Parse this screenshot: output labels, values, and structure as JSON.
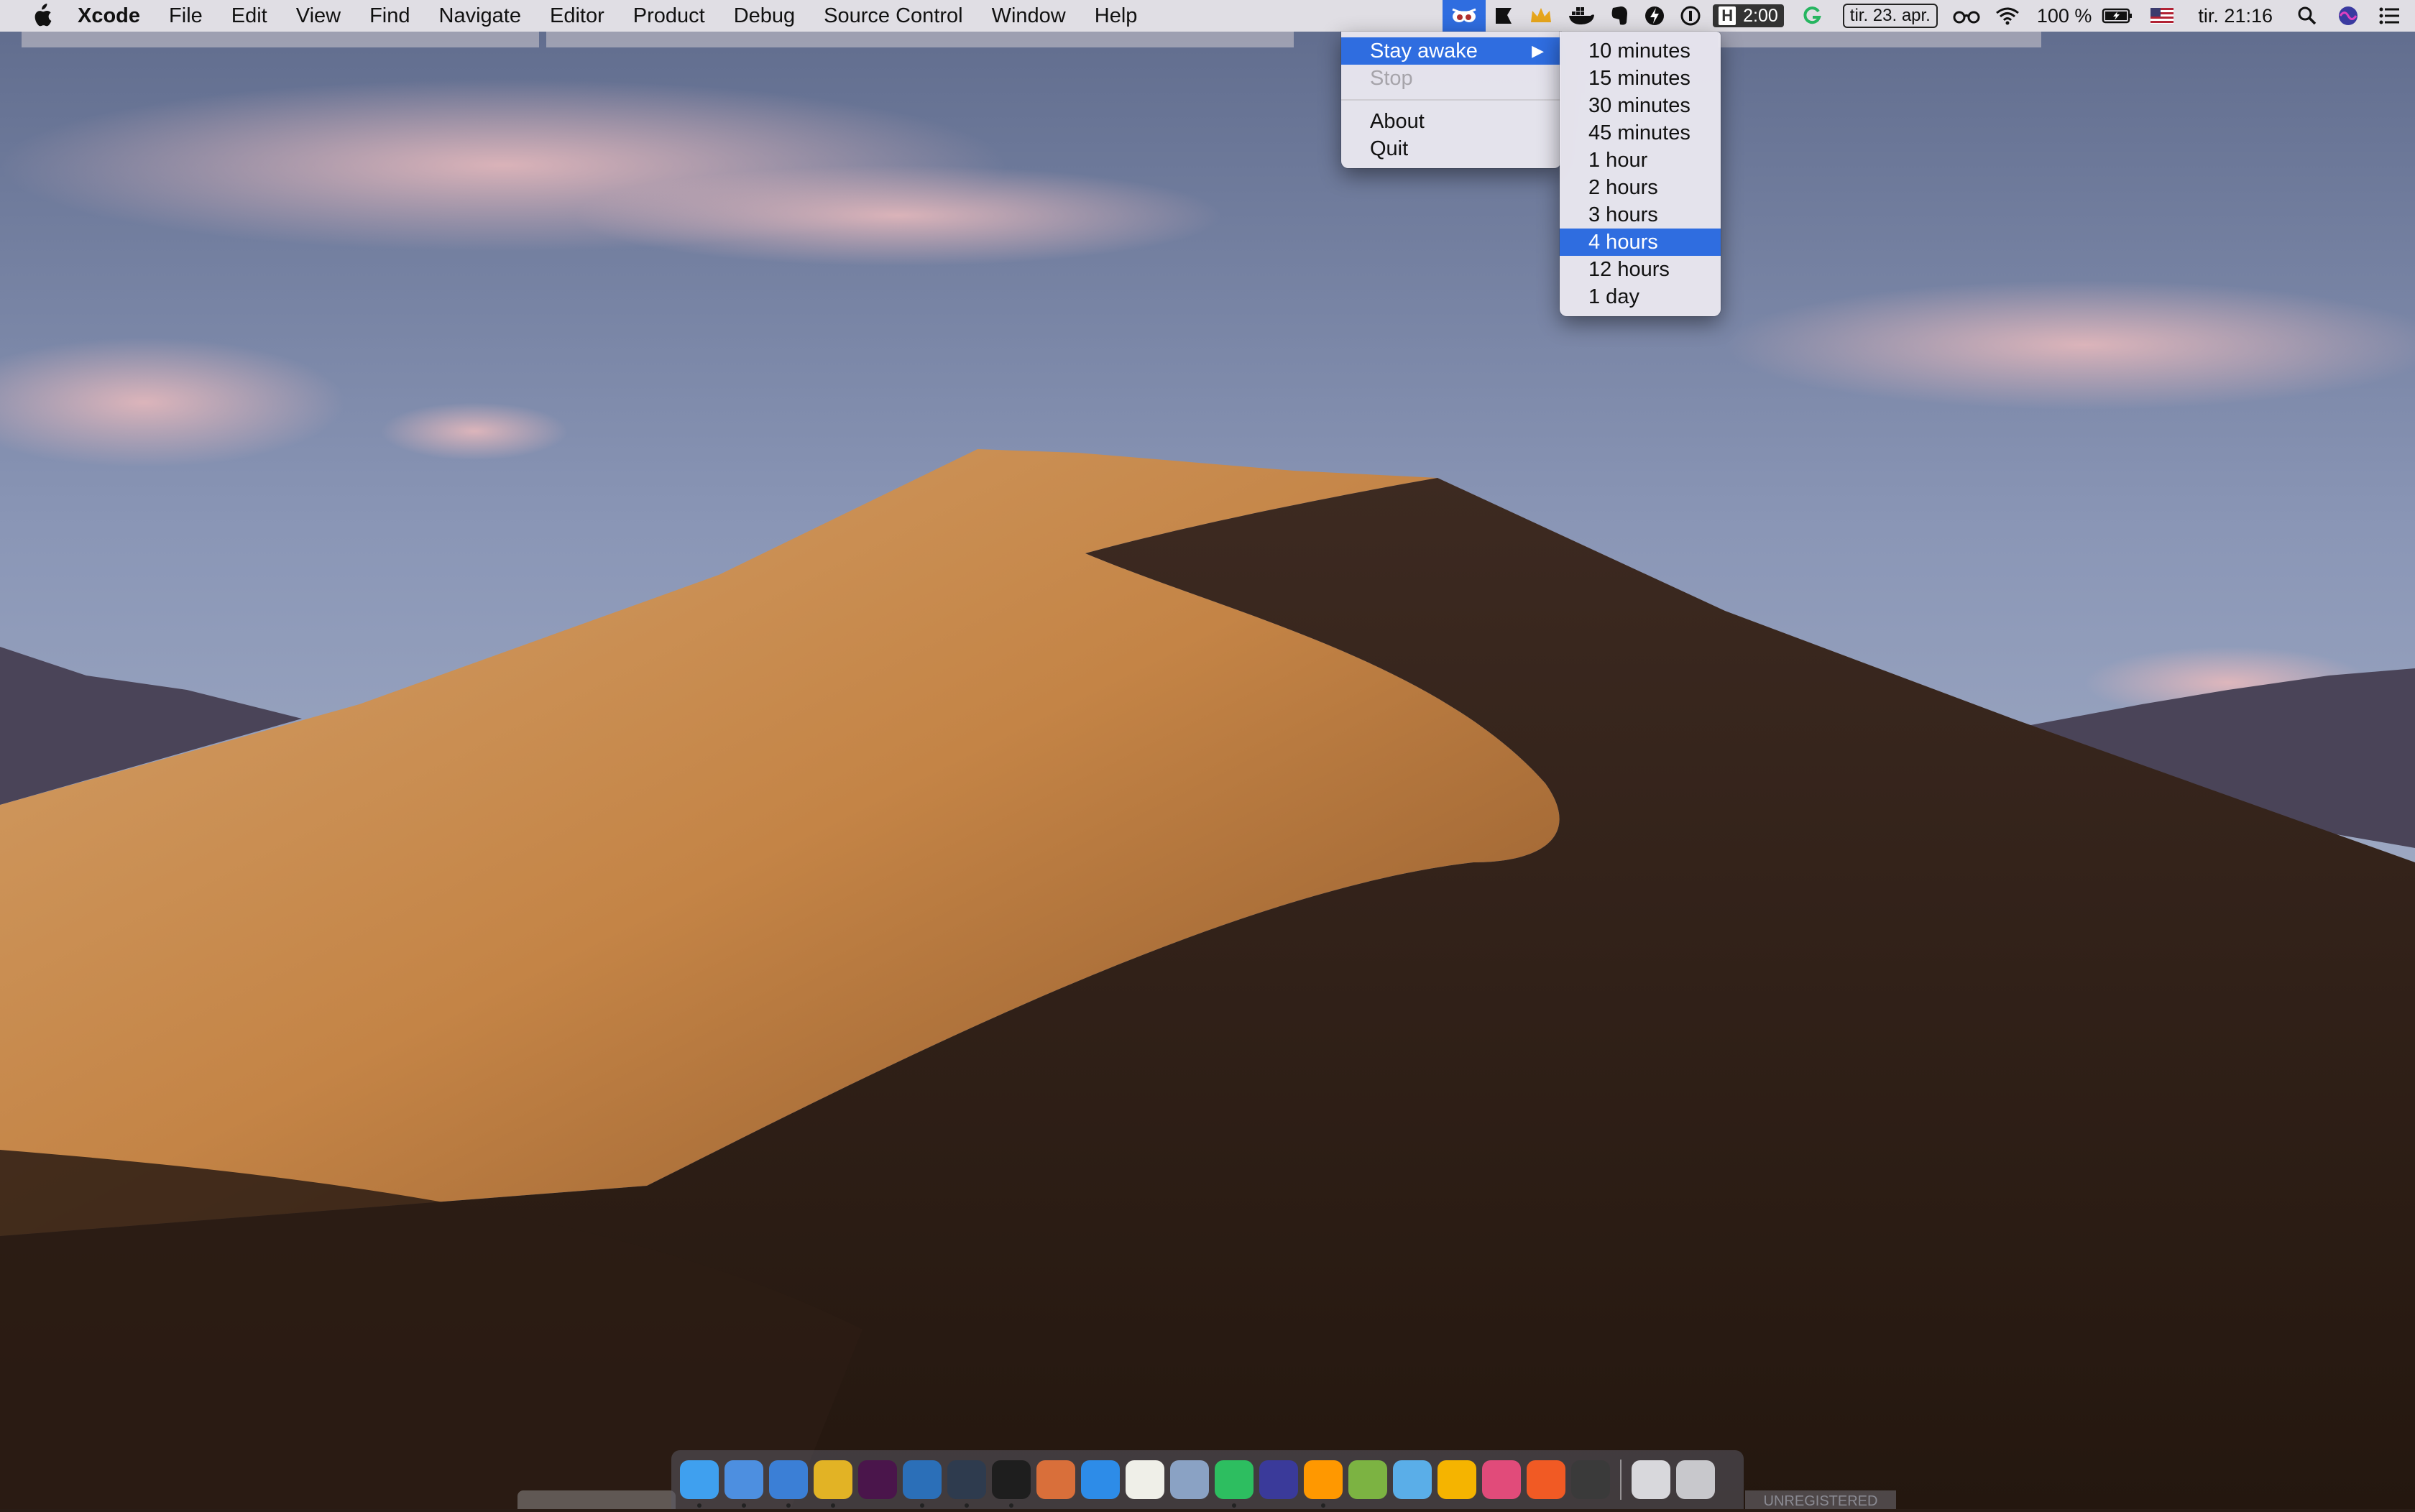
{
  "menubar": {
    "app_name": "Xcode",
    "menus": [
      "File",
      "Edit",
      "View",
      "Find",
      "Navigate",
      "Editor",
      "Product",
      "Debug",
      "Source Control",
      "Window",
      "Help"
    ],
    "status": {
      "timer_label": "H",
      "timer_value": "2:00",
      "date": "tir. 23. apr.",
      "battery": "100 %",
      "time": "tir. 21:16"
    }
  },
  "status_icons": [
    "owly-eye-icon",
    "notification-bell-icon",
    "crown-icon",
    "docker-icon",
    "evernote-icon",
    "lightning-icon",
    "1password-icon",
    "grammarly-icon",
    "glasses-icon",
    "wifi-icon",
    "battery-icon",
    "us-flag-icon",
    "spotlight-search-icon",
    "siri-icon",
    "notification-center-icon"
  ],
  "app_menu": {
    "items": [
      {
        "label": "Stay awake",
        "state": "highlighted",
        "submenu": true
      },
      {
        "label": "Stop",
        "state": "disabled"
      },
      {
        "label": "About",
        "state": "normal"
      },
      {
        "label": "Quit",
        "state": "normal"
      }
    ],
    "submenu_arrow": "▶"
  },
  "duration_submenu": {
    "items": [
      "10 minutes",
      "15 minutes",
      "30 minutes",
      "45 minutes",
      "1 hour",
      "2 hours",
      "3 hours",
      "4 hours",
      "12 hours",
      "1 day"
    ],
    "selected": "4 hours"
  },
  "dock": {
    "apps": [
      {
        "name": "finder",
        "color": "#3fa0ef",
        "running": true
      },
      {
        "name": "xcode",
        "color": "#4d8fe0",
        "running": true
      },
      {
        "name": "simulator",
        "color": "#3b7fd6",
        "running": true
      },
      {
        "name": "chrome",
        "color": "#e2b325",
        "running": true
      },
      {
        "name": "slack",
        "color": "#4a154b",
        "running": false
      },
      {
        "name": "visual-studio-code",
        "color": "#2b6fb8",
        "running": true
      },
      {
        "name": "terminal-prompt",
        "color": "#2e3b4e",
        "running": true
      },
      {
        "name": "terminal",
        "color": "#1e1e1e",
        "running": true
      },
      {
        "name": "mosaic",
        "color": "#d96f3a",
        "running": false
      },
      {
        "name": "safari",
        "color": "#2d8ce8",
        "running": false
      },
      {
        "name": "notes",
        "color": "#efefe8",
        "running": false
      },
      {
        "name": "preview",
        "color": "#8aa2c4",
        "running": false
      },
      {
        "name": "evernote",
        "color": "#2dbe60",
        "running": true
      },
      {
        "name": "moon-app",
        "color": "#3a3a9a",
        "running": false
      },
      {
        "name": "sublime-text",
        "color": "#ff9800",
        "running": true
      },
      {
        "name": "android-studio",
        "color": "#7cb342",
        "running": false
      },
      {
        "name": "folder",
        "color": "#5aaee8",
        "running": false
      },
      {
        "name": "sketch",
        "color": "#f5b400",
        "running": false
      },
      {
        "name": "photo-booth",
        "color": "#e14b7a",
        "running": false
      },
      {
        "name": "brave",
        "color": "#f15a24",
        "running": false
      },
      {
        "name": "grammarly",
        "color": "#3a3a3a",
        "running": false
      }
    ],
    "stack_apps": [
      {
        "name": "downloads-stack",
        "color": "#d8d8dc"
      },
      {
        "name": "trash",
        "color": "#c8c8cc"
      }
    ]
  },
  "watermark": "UNREGISTERED",
  "colors": {
    "menu_highlight": "#2f6de0",
    "menubar_bg": "#ece8ec"
  }
}
